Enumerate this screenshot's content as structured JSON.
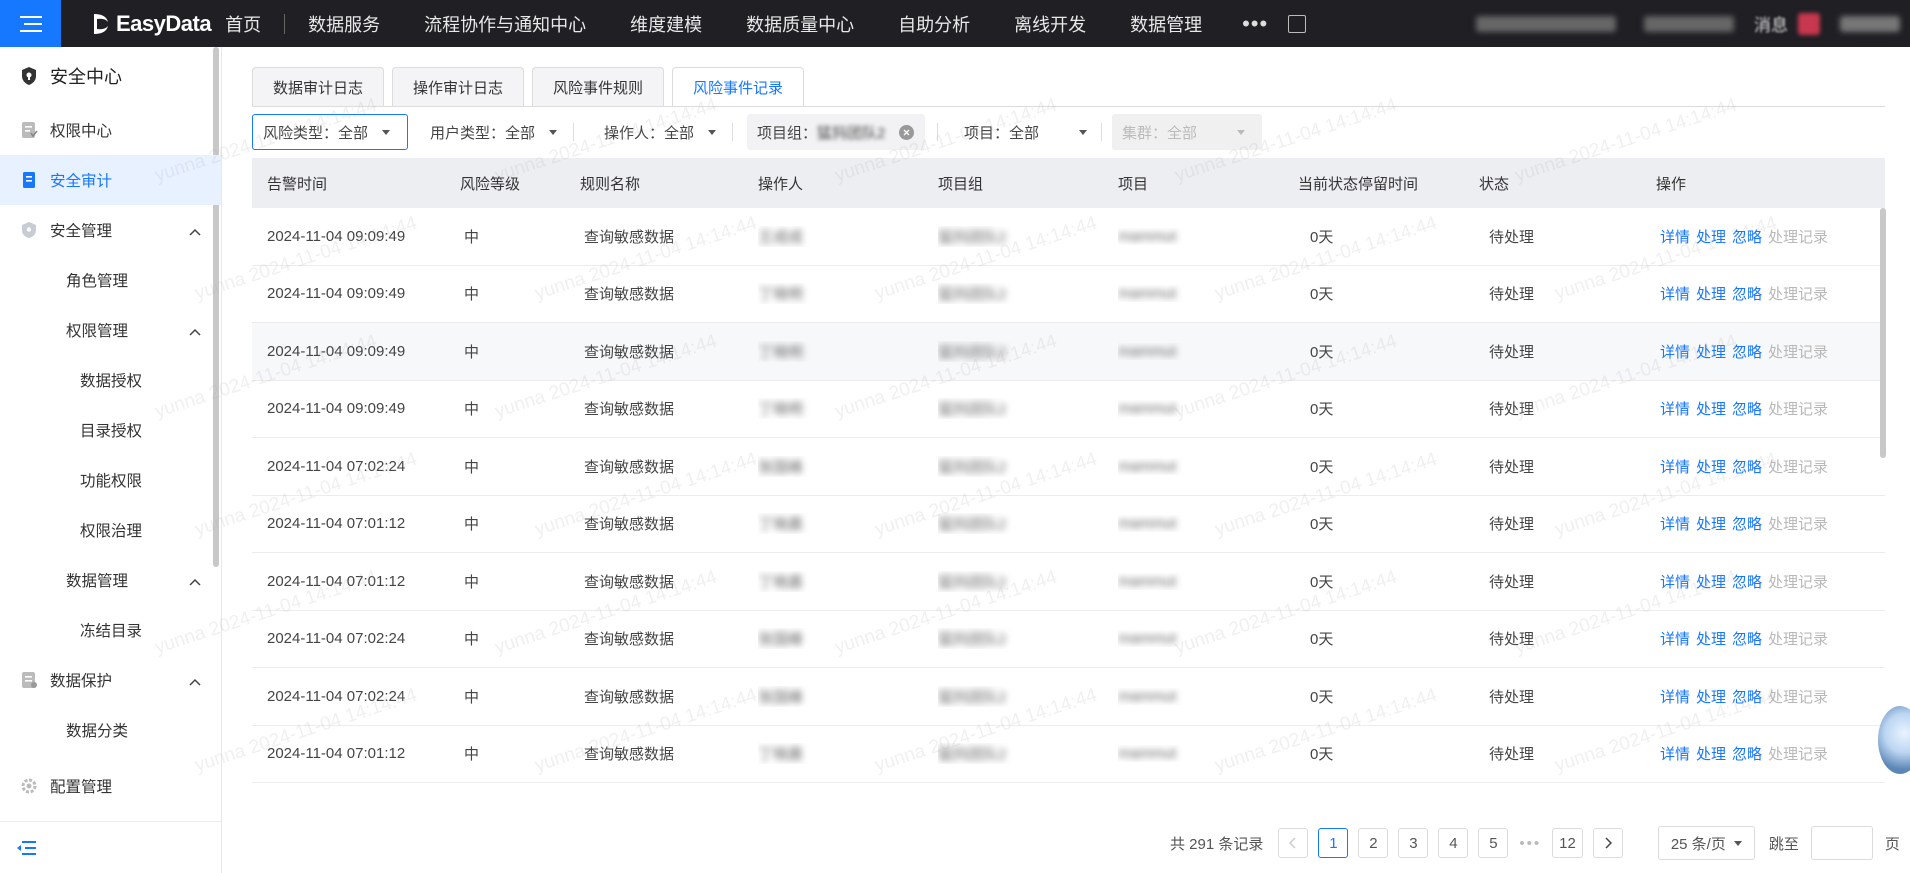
{
  "app": {
    "brand": "EasyData"
  },
  "topnav": {
    "items": [
      "首页",
      "数据服务",
      "流程协作与通知中心",
      "维度建模",
      "数据质量中心",
      "自助分析",
      "离线开发",
      "数据管理"
    ],
    "more": "•••",
    "message": "消息"
  },
  "sidebar": {
    "title": "安全中心",
    "items": [
      {
        "label": "权限中心",
        "level": 1
      },
      {
        "label": "安全审计",
        "level": 1,
        "active": true
      },
      {
        "label": "安全管理",
        "level": 1,
        "expanded": true
      },
      {
        "label": "角色管理",
        "level": 2
      },
      {
        "label": "权限管理",
        "level": 2,
        "expanded": true
      },
      {
        "label": "数据授权",
        "level": 3
      },
      {
        "label": "目录授权",
        "level": 3
      },
      {
        "label": "功能权限",
        "level": 3
      },
      {
        "label": "权限治理",
        "level": 3
      },
      {
        "label": "数据管理",
        "level": 2,
        "expanded": true
      },
      {
        "label": "冻结目录",
        "level": 3
      },
      {
        "label": "数据保护",
        "level": 1,
        "expanded": true
      },
      {
        "label": "数据分类",
        "level": 2
      },
      {
        "label": "配置管理",
        "level": 1
      }
    ]
  },
  "tabs": [
    {
      "label": "数据审计日志"
    },
    {
      "label": "操作审计日志"
    },
    {
      "label": "风险事件规则"
    },
    {
      "label": "风险事件记录",
      "active": true
    }
  ],
  "filters": {
    "risk_type": "风险类型：全部",
    "user_type": "用户类型：全部",
    "operator": "操作人：全部",
    "project_group_label": "项目组：",
    "project_group_value": "猛犸团队2",
    "project": "项目：全部",
    "cluster": "集群：全部"
  },
  "table": {
    "headers": [
      "告警时间",
      "风险等级",
      "规则名称",
      "操作人",
      "项目组",
      "项目",
      "当前状态停留时间",
      "状态",
      "操作"
    ],
    "actions": [
      "详情",
      "处理",
      "忽略",
      "处理记录"
    ],
    "rows": [
      {
        "time": "2024-11-04 09:09:49",
        "level": "中",
        "rule": "查询敏感数据",
        "operator": "王成成",
        "group": "猛犸团队2",
        "project": "mammut",
        "stay": "0天",
        "status": "待处理"
      },
      {
        "time": "2024-11-04 09:09:49",
        "level": "中",
        "rule": "查询敏感数据",
        "operator": "丁晓明",
        "group": "猛犸团队2",
        "project": "mammut",
        "stay": "0天",
        "status": "待处理"
      },
      {
        "time": "2024-11-04 09:09:49",
        "level": "中",
        "rule": "查询敏感数据",
        "operator": "丁晓明",
        "group": "猛犸团队2",
        "project": "mammut",
        "stay": "0天",
        "status": "待处理"
      },
      {
        "time": "2024-11-04 09:09:49",
        "level": "中",
        "rule": "查询敏感数据",
        "operator": "丁晓明",
        "group": "猛犸团队2",
        "project": "mammut",
        "stay": "0天",
        "status": "待处理"
      },
      {
        "time": "2024-11-04 07:02:24",
        "level": "中",
        "rule": "查询敏感数据",
        "operator": "张国峰",
        "group": "猛犸团队2",
        "project": "mammut",
        "stay": "0天",
        "status": "待处理"
      },
      {
        "time": "2024-11-04 07:01:12",
        "level": "中",
        "rule": "查询敏感数据",
        "operator": "丁晓晨",
        "group": "猛犸团队2",
        "project": "mammut",
        "stay": "0天",
        "status": "待处理"
      },
      {
        "time": "2024-11-04 07:01:12",
        "level": "中",
        "rule": "查询敏感数据",
        "operator": "丁晓晨",
        "group": "猛犸团队2",
        "project": "mammut",
        "stay": "0天",
        "status": "待处理"
      },
      {
        "time": "2024-11-04 07:02:24",
        "level": "中",
        "rule": "查询敏感数据",
        "operator": "张国峰",
        "group": "猛犸团队2",
        "project": "mammut",
        "stay": "0天",
        "status": "待处理"
      },
      {
        "time": "2024-11-04 07:02:24",
        "level": "中",
        "rule": "查询敏感数据",
        "operator": "张国峰",
        "group": "猛犸团队2",
        "project": "mammut",
        "stay": "0天",
        "status": "待处理"
      },
      {
        "time": "2024-11-04 07:01:12",
        "level": "中",
        "rule": "查询敏感数据",
        "operator": "丁晓晨",
        "group": "猛犸团队2",
        "project": "mammut",
        "stay": "0天",
        "status": "待处理"
      }
    ]
  },
  "pagination": {
    "total": "共 291 条记录",
    "pages": [
      "1",
      "2",
      "3",
      "4",
      "5"
    ],
    "dots": "•••",
    "last": "12",
    "page_size": "25 条/页",
    "jump_label": "跳至",
    "jump_unit": "页"
  },
  "watermark": "yunna 2024-11-04 14:14:44"
}
